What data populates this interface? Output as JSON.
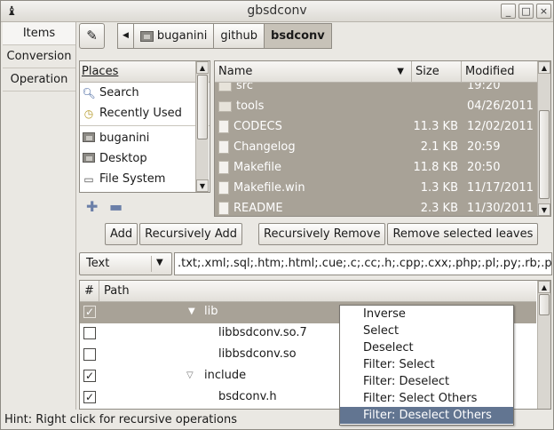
{
  "window": {
    "title": "gbsdconv",
    "controls": [
      "_",
      "□",
      "×"
    ]
  },
  "nav": {
    "tabs": [
      "Items",
      "Conversion",
      "Operation"
    ],
    "active": 0
  },
  "pathbar": {
    "edit_icon": "pencil-icon",
    "back_icon": "left-arrow-icon",
    "crumbs": [
      "buganini",
      "github",
      "bsdconv"
    ]
  },
  "places": {
    "header": "Places",
    "items": [
      "Search",
      "Recently Used",
      "buganini",
      "Desktop",
      "File System"
    ],
    "icons": [
      "search-icon",
      "clock-icon",
      "home-folder-icon",
      "desktop-icon",
      "drive-icon"
    ]
  },
  "files": {
    "headers": {
      "name": "Name",
      "size": "Size",
      "modified": "Modified"
    },
    "rows": [
      {
        "name": "src",
        "size": "",
        "modified": "19:20",
        "type": "folder"
      },
      {
        "name": "tools",
        "size": "",
        "modified": "04/26/2011",
        "type": "folder"
      },
      {
        "name": "CODECS",
        "size": "11.3 KB",
        "modified": "12/02/2011",
        "type": "file"
      },
      {
        "name": "Changelog",
        "size": "2.1 KB",
        "modified": "20:59",
        "type": "file"
      },
      {
        "name": "Makefile",
        "size": "11.8 KB",
        "modified": "20:50",
        "type": "file"
      },
      {
        "name": "Makefile.win",
        "size": "1.3 KB",
        "modified": "11/17/2011",
        "type": "file"
      },
      {
        "name": "README",
        "size": "2.3 KB",
        "modified": "11/30/2011",
        "type": "file"
      }
    ]
  },
  "buttons": {
    "add": "Add",
    "recursively_add": "Recursively Add",
    "recursively_remove": "Recursively Remove",
    "remove_selected_leaves": "Remove selected leaves"
  },
  "filter": {
    "type_selected": "Text",
    "extensions": ".txt;.xml;.sql;.htm;.html;.cue;.c;.cc;.h;.cpp;.cxx;.php;.pl;.py;.rb;.php"
  },
  "tree": {
    "headers": {
      "check": "#",
      "path": "Path"
    },
    "rows": [
      {
        "label": "lib",
        "checked": true,
        "expander": "down",
        "selected": true
      },
      {
        "label": "libbsdconv.so.7",
        "checked": false,
        "expander": "",
        "selected": false
      },
      {
        "label": "libbsdconv.so",
        "checked": false,
        "expander": "",
        "selected": false
      },
      {
        "label": "include",
        "checked": true,
        "expander": "down",
        "selected": false
      },
      {
        "label": "bsdconv.h",
        "checked": true,
        "expander": "",
        "selected": false
      }
    ]
  },
  "context_menu": {
    "items": [
      "Inverse",
      "Select",
      "Deselect",
      "Filter: Select",
      "Filter: Deselect",
      "Filter: Select Others",
      "Filter: Deselect Others"
    ],
    "highlighted": 6
  },
  "status": {
    "hint": "Hint: Right click for recursive operations"
  }
}
